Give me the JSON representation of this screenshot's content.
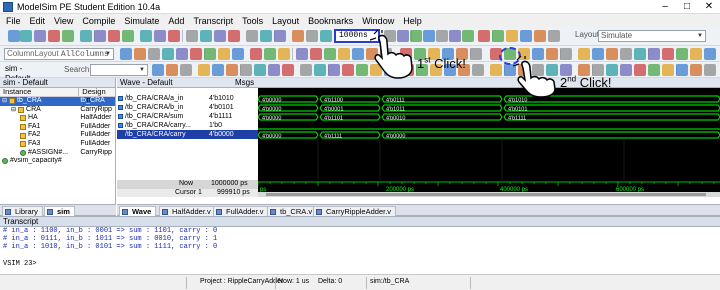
{
  "titlebar": {
    "title": "ModelSim PE Student Edition 10.4a",
    "min": "–",
    "max": "□",
    "close": "✕"
  },
  "menu": [
    "File",
    "Edit",
    "View",
    "Compile",
    "Simulate",
    "Add",
    "Transcript",
    "Tools",
    "Layout",
    "Bookmarks",
    "Window",
    "Help"
  ],
  "toolbar": {
    "run_length": "1000ns",
    "layout_label": "Layout",
    "layout_value": "Simulate",
    "column_layout_label": "ColumnLayout",
    "column_layout_value": "AllColumns",
    "search_label": "Search:",
    "sim_label": "sim - Default"
  },
  "sim_panel": {
    "header": "sim - Default",
    "col_instance": "Instance",
    "col_design": "Design un",
    "rows": [
      {
        "name": "tb_CRA",
        "unit": "tb_CRA",
        "indent": 0,
        "kind": "inst",
        "selected": true
      },
      {
        "name": "CRA",
        "unit": "CarryRipp",
        "indent": 1,
        "kind": "inst"
      },
      {
        "name": "HA",
        "unit": "HalfAdder",
        "indent": 2,
        "kind": "inst"
      },
      {
        "name": "FA1",
        "unit": "FullAdder",
        "indent": 2,
        "kind": "inst"
      },
      {
        "name": "FA2",
        "unit": "FullAdder",
        "indent": 2,
        "kind": "inst"
      },
      {
        "name": "FA3",
        "unit": "FullAdder",
        "indent": 2,
        "kind": "inst"
      },
      {
        "name": "#ASSIGN#...",
        "unit": "CarryRipp",
        "indent": 2,
        "kind": "proc"
      },
      {
        "name": "#vsim_capacity#",
        "unit": "",
        "indent": 0,
        "kind": "proc"
      }
    ]
  },
  "wave": {
    "header": "Wave - Default",
    "msgs_label": "Msgs",
    "signals": [
      {
        "name": "/tb_CRA/CRA/a_in",
        "value": "4'b1010",
        "segments": [
          "4'b0000",
          "4'b1100",
          "4'b0111",
          "4'b1010"
        ]
      },
      {
        "name": "/tb_CRA/CRA/b_in",
        "value": "4'b0101",
        "segments": [
          "4'b0000",
          "4'b0001",
          "4'b1011",
          "4'b0101"
        ]
      },
      {
        "name": "/tb_CRA/CRA/sum",
        "value": "4'b1111",
        "segments": [
          "4'b0000",
          "4'b1101",
          "4'b0010",
          "4'b1111"
        ]
      },
      {
        "name": "/tb_CRA/CRA/carry...",
        "value": "1'b0",
        "segments": []
      },
      {
        "name": "/tb_CRA/CRA/carry",
        "value": "4'b0000",
        "segments": [
          "4'b0000",
          "4'b1111",
          "4'b0000"
        ],
        "selected": true
      }
    ],
    "now_label": "Now",
    "now_value": "1000000 ps",
    "cursor_label": "Cursor 1",
    "cursor_value": "999910 ps",
    "ruler": [
      "ps",
      "200000 ps",
      "400000 ps",
      "600000 ps"
    ]
  },
  "tabs_left": [
    "Library",
    "sim"
  ],
  "tabs_wave": [
    "Wave",
    "HalfAdder.v",
    "FullAdder.v",
    "tb_CRA.v",
    "CarryRippleAdder.v"
  ],
  "transcript": {
    "header": "Transcript",
    "lines": [
      "# in_a : 1100, in_b : 0001 => sum : 1101, carry : 0",
      "# in_a : 0111, in_b : 1011 => sum : 0010, carry : 1",
      "# in_a : 1010, in_b : 0101 => sum : 1111, carry : 0"
    ],
    "prompt": "VSIM 23>"
  },
  "status": {
    "project": "Project : RippleCarryAdder",
    "now": "Now: 1 us",
    "delta": "Delta: 0",
    "context": "sim:/tb_CRA"
  },
  "annotations": {
    "first_click": "1st Click!",
    "second_click": "2nd Click!"
  },
  "colors": {
    "wave_bg": "#000000",
    "wave_signal": "#00ff00",
    "ruler_text": "#00ff00",
    "highlight": "#2b3bd6",
    "selected": "#1e3ea8"
  }
}
